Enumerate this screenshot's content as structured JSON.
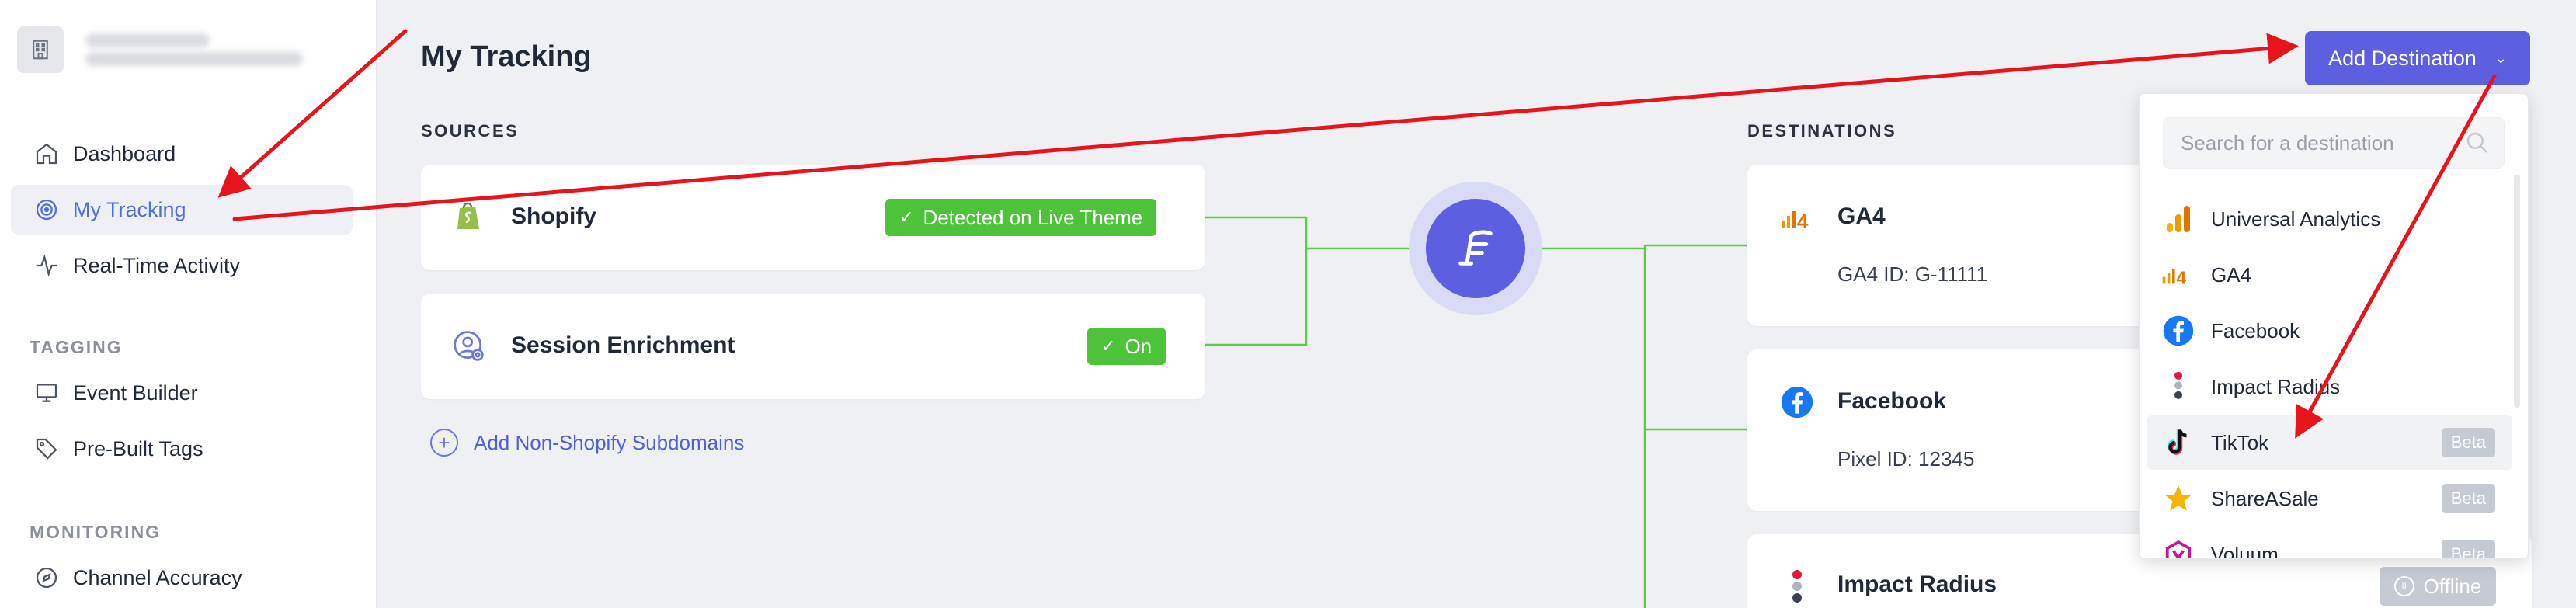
{
  "sidebar": {
    "nav": [
      {
        "label": "Dashboard",
        "icon": "home-icon"
      },
      {
        "label": "My Tracking",
        "icon": "target-icon",
        "active": true
      },
      {
        "label": "Real-Time Activity",
        "icon": "activity-icon"
      }
    ],
    "tagging_label": "TAGGING",
    "tagging": [
      {
        "label": "Event Builder",
        "icon": "monitor-icon"
      },
      {
        "label": "Pre-Built Tags",
        "icon": "tag-icon"
      }
    ],
    "monitoring_label": "MONITORING",
    "monitoring": [
      {
        "label": "Channel Accuracy",
        "icon": "compass-icon"
      }
    ]
  },
  "main": {
    "title": "My Tracking",
    "sources_label": "SOURCES",
    "destinations_label": "DESTINATIONS",
    "sources": [
      {
        "name": "Shopify",
        "status": "Detected on Live Theme",
        "icon": "shopify-icon"
      },
      {
        "name": "Session Enrichment",
        "status": "On",
        "icon": "user-settings-icon"
      }
    ],
    "add_subdomains": "Add Non-Shopify Subdomains",
    "destinations": [
      {
        "name": "GA4",
        "detail": "GA4 ID: G-11111",
        "icon": "ga4-icon"
      },
      {
        "name": "Facebook",
        "detail": "Pixel ID: 12345",
        "icon": "facebook-icon"
      },
      {
        "name": "Impact Radius",
        "status": "Offline",
        "icon": "impact-icon"
      }
    ]
  },
  "add_destination": {
    "label": "Add Destination",
    "search_placeholder": "Search for a destination",
    "options": [
      {
        "label": "Universal Analytics",
        "icon": "ua-icon"
      },
      {
        "label": "GA4",
        "icon": "ga4-icon"
      },
      {
        "label": "Facebook",
        "icon": "facebook-icon"
      },
      {
        "label": "Impact Radius",
        "icon": "impact-icon"
      },
      {
        "label": "TikTok",
        "icon": "tiktok-icon",
        "badge": "Beta"
      },
      {
        "label": "ShareASale",
        "icon": "star-icon",
        "badge": "Beta"
      },
      {
        "label": "Voluum",
        "icon": "voluum-icon",
        "badge": "Beta"
      }
    ]
  },
  "colors": {
    "accent": "#5b5fe0",
    "success": "#4cc338",
    "annotation": "#e8141c"
  }
}
